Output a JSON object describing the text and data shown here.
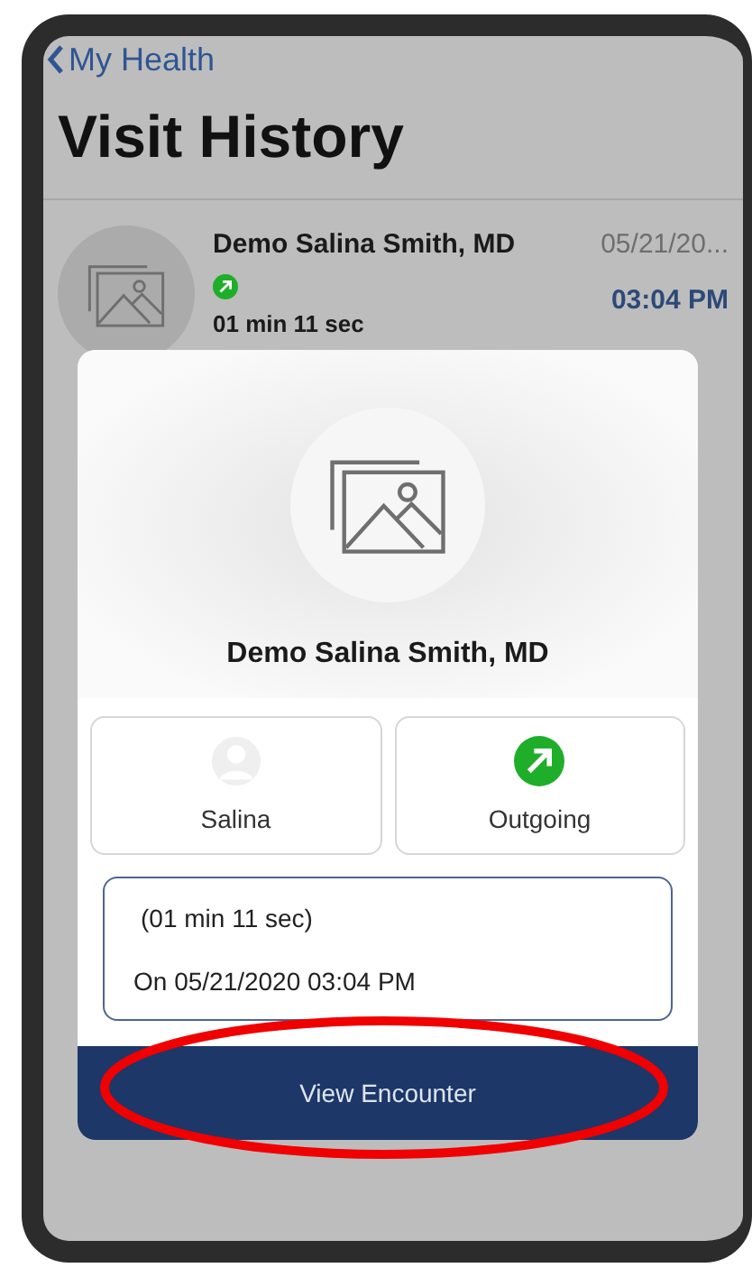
{
  "header": {
    "back_label": "My Health",
    "title": "Visit History"
  },
  "visits": [
    {
      "name": "Demo Salina Smith, MD",
      "date": "05/21/20...",
      "time": "03:04 PM",
      "kind": "outgoing",
      "duration": "01 min 11 sec"
    }
  ],
  "dialog": {
    "name": "Demo Salina Smith, MD",
    "tiles": [
      {
        "kind": "contact",
        "label": "Salina"
      },
      {
        "kind": "outgoing",
        "label": "Outgoing"
      }
    ],
    "duration": "(01 min 11 sec)",
    "datetime": "On 05/21/2020 03:04 PM",
    "button": "View Encounter"
  }
}
